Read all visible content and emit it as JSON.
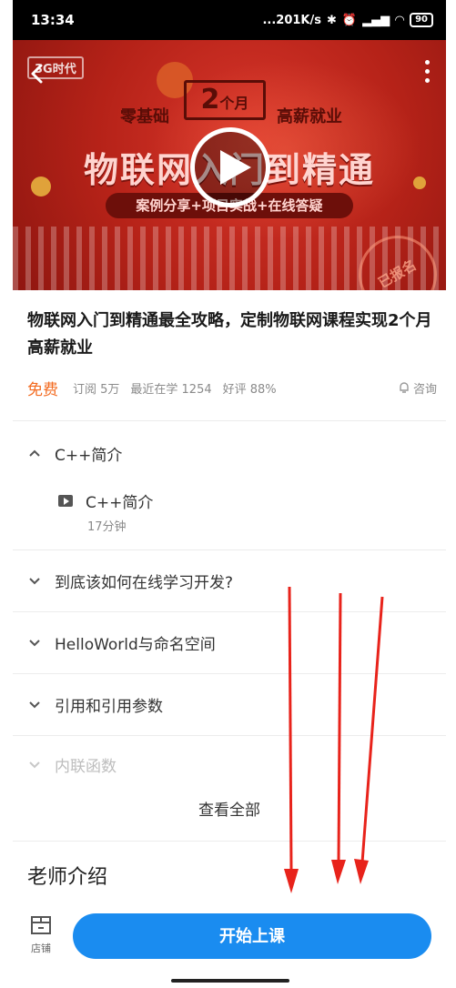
{
  "status_bar": {
    "time": "13:34",
    "network_speed": "...201K/s",
    "battery": "90"
  },
  "video": {
    "logo_text": "3G时代",
    "badge_number": "2",
    "badge_unit": "个月",
    "subtitle_left": "零基础",
    "subtitle_right": "高薪就业",
    "title": "物联网入门到精通",
    "pill": "案例分享+项目实战+在线答疑",
    "stamp": "已报名"
  },
  "course": {
    "title": "物联网入门到精通最全攻略，定制物联网课程实现2个月高薪就业",
    "price": "免费",
    "subscriptions": "订阅 5万",
    "recent_learners": "最近在学 1254",
    "rating": "好评 88%",
    "consult": "咨询"
  },
  "chapters": [
    {
      "title": "C++简介",
      "expanded": true
    },
    {
      "title": "到底该如何在线学习开发?",
      "expanded": false
    },
    {
      "title": "HelloWorld与命名空间",
      "expanded": false
    },
    {
      "title": "引用和引用参数",
      "expanded": false
    },
    {
      "title": "内联函数",
      "expanded": false
    }
  ],
  "lesson": {
    "title": "C++简介",
    "duration": "17分钟"
  },
  "view_all": "查看全部",
  "teacher_section": "老师介绍",
  "bottom_bar": {
    "store_label": "店铺",
    "start_button": "开始上课"
  },
  "colors": {
    "accent_blue": "#1a8cf0",
    "price_orange": "#f36b21",
    "annotation_red": "#e8231b"
  }
}
